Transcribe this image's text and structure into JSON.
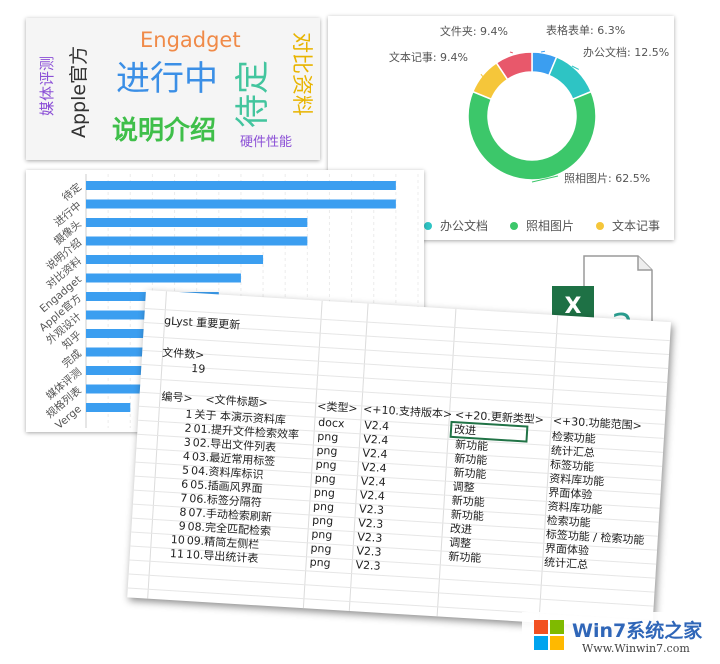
{
  "wordcloud": {
    "words": [
      {
        "text": "Engadget",
        "color": "#f08a48"
      },
      {
        "text": "进行中",
        "color": "#3b8fe6"
      },
      {
        "text": "Apple官方",
        "color": "#333333"
      },
      {
        "text": "媒体评测",
        "color": "#8b4fd6"
      },
      {
        "text": "说明介绍",
        "color": "#3fbf4a"
      },
      {
        "text": "待定",
        "color": "#43c59e"
      },
      {
        "text": "对比资料",
        "color": "#e8b400"
      },
      {
        "text": "硬件性能",
        "color": "#8b4fd6"
      }
    ]
  },
  "chart_data": [
    {
      "type": "pie",
      "donut": true,
      "categories": [
        "照相图片",
        "文本记事",
        "文件夹",
        "表格表单",
        "办公文档"
      ],
      "values": [
        62.5,
        9.4,
        9.4,
        6.3,
        12.5
      ],
      "labels": [
        "照相图片: 62.5%",
        "文本记事: 9.4%",
        "文件夹: 9.4%",
        "表格表单: 6.3%",
        "办公文档: 12.5%"
      ],
      "colors": [
        "#3cc76a",
        "#f5c63a",
        "#e8586b",
        "#3b9ef0",
        "#2ec4c4"
      ],
      "legend": [
        "办公文档",
        "照相图片",
        "文本记事"
      ],
      "legend_colors": [
        "#2ec4c4",
        "#3cc76a",
        "#f5c63a"
      ],
      "legend_position": "bottom"
    },
    {
      "type": "bar",
      "orientation": "horizontal",
      "categories": [
        "待定",
        "进行中",
        "摄像头",
        "说明介绍",
        "对比资料",
        "Engadget",
        "Apple官方",
        "外观设计",
        "知乎",
        "完成",
        "媒体评测",
        "规格列表",
        "Verge"
      ],
      "values": [
        14,
        14,
        10,
        10,
        8,
        7,
        6,
        6,
        4,
        4,
        3,
        3,
        2
      ],
      "xlim": [
        0,
        15
      ],
      "grid": true,
      "color": "#3b9ef0"
    }
  ],
  "spreadsheet": {
    "title_row": "gLyst 重要更新",
    "count_label": "文件数>",
    "count_value": "19",
    "headers": [
      "编号>",
      "<文件标题>",
      "<类型>",
      "<+10.支持版本>",
      "<+20.更新类型>",
      "<+30.功能范围>"
    ],
    "rows": [
      {
        "no": "1",
        "title": "关于 本演示资料库",
        "type": "docx",
        "ver": "V2.4",
        "upd": "改进",
        "scope": "检索功能"
      },
      {
        "no": "2",
        "title": "01.提升文件检索效率",
        "type": "png",
        "ver": "V2.4",
        "upd": "新功能",
        "scope": "统计汇总"
      },
      {
        "no": "3",
        "title": "02.导出文件列表",
        "type": "png",
        "ver": "V2.4",
        "upd": "新功能",
        "scope": "标签功能"
      },
      {
        "no": "4",
        "title": "03.最近常用标签",
        "type": "png",
        "ver": "V2.4",
        "upd": "新功能",
        "scope": "资料库功能"
      },
      {
        "no": "5",
        "title": "04.资料库标识",
        "type": "png",
        "ver": "V2.4",
        "upd": "调整",
        "scope": "界面体验"
      },
      {
        "no": "6",
        "title": "05.插画风界面",
        "type": "png",
        "ver": "V2.4",
        "upd": "新功能",
        "scope": "资料库功能"
      },
      {
        "no": "7",
        "title": "06.标签分隔符",
        "type": "png",
        "ver": "V2.3",
        "upd": "新功能",
        "scope": "检索功能"
      },
      {
        "no": "8",
        "title": "07.手动检索刷新",
        "type": "png",
        "ver": "V2.3",
        "upd": "改进",
        "scope": "标签功能 / 检索功能"
      },
      {
        "no": "9",
        "title": "08.完全匹配检索",
        "type": "png",
        "ver": "V2.3",
        "upd": "调整",
        "scope": "界面体验"
      },
      {
        "no": "10",
        "title": "09.精简左侧栏",
        "type": "png",
        "ver": "V2.3",
        "upd": "新功能",
        "scope": "统计汇总"
      },
      {
        "no": "11",
        "title": "10.导出统计表",
        "type": "png",
        "ver": "V2.3",
        "upd": "",
        "scope": ""
      }
    ]
  },
  "file_icon": {
    "excel_letter": "X",
    "text_letter": "a",
    "excel_color": "#1e7145",
    "text_color": "#2a9d8f"
  },
  "watermark": {
    "brand": "Win7系统之家",
    "url": "Www.Winwin7.com"
  }
}
